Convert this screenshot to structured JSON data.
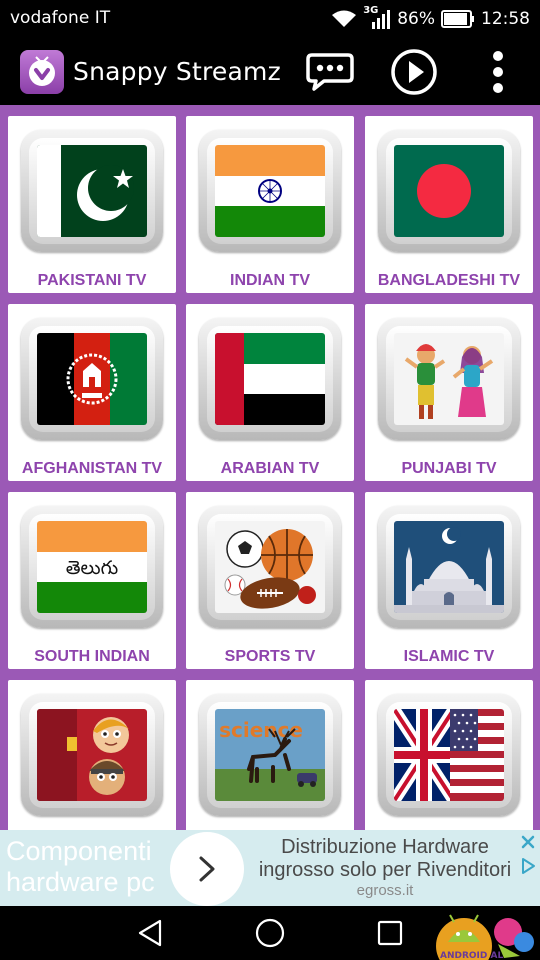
{
  "status_bar": {
    "carrier": "vodafone IT",
    "network": "3G",
    "battery": "86%",
    "time": "12:58"
  },
  "app_bar": {
    "title": "Snappy Streamz",
    "actions": [
      "chat-icon",
      "play-icon",
      "overflow-menu-icon"
    ]
  },
  "channels": [
    {
      "label": "PAKISTANI TV",
      "icon": "pakistan-flag-icon"
    },
    {
      "label": "INDIAN TV",
      "icon": "india-flag-icon"
    },
    {
      "label": "BANGLADESHI TV",
      "icon": "bangladesh-flag-icon"
    },
    {
      "label": "AFGHANISTAN TV",
      "icon": "afghanistan-flag-icon"
    },
    {
      "label": "ARABIAN TV",
      "icon": "uae-flag-icon"
    },
    {
      "label": "PUNJABI TV",
      "icon": "punjabi-dancers-icon"
    },
    {
      "label": "SOUTH INDIAN",
      "icon": "telugu-flag-icon",
      "art_text": "తెలుగు"
    },
    {
      "label": "SPORTS TV",
      "icon": "sports-balls-icon"
    },
    {
      "label": "ISLAMIC TV",
      "icon": "mosque-icon"
    },
    {
      "label": "",
      "icon": "kids-cartoon-icon"
    },
    {
      "label": "",
      "icon": "science-deer-icon",
      "art_text": "science"
    },
    {
      "label": "",
      "icon": "uk-us-flags-icon"
    }
  ],
  "ad": {
    "left_text_line1": "Componenti",
    "left_text_line2": "hardware pc",
    "right_text_line1": "Distribuzione Hardware",
    "right_text_line2": "ingrosso solo per Rivenditori",
    "domain": "egross.it"
  },
  "colors": {
    "accent": "#9b59b6",
    "label": "#8e44ad",
    "ad_background": "#d6ecef"
  },
  "nav_bar": {
    "buttons": [
      "back-icon",
      "home-icon",
      "recents-icon"
    ],
    "watermark_text": "ANDROID AL"
  }
}
